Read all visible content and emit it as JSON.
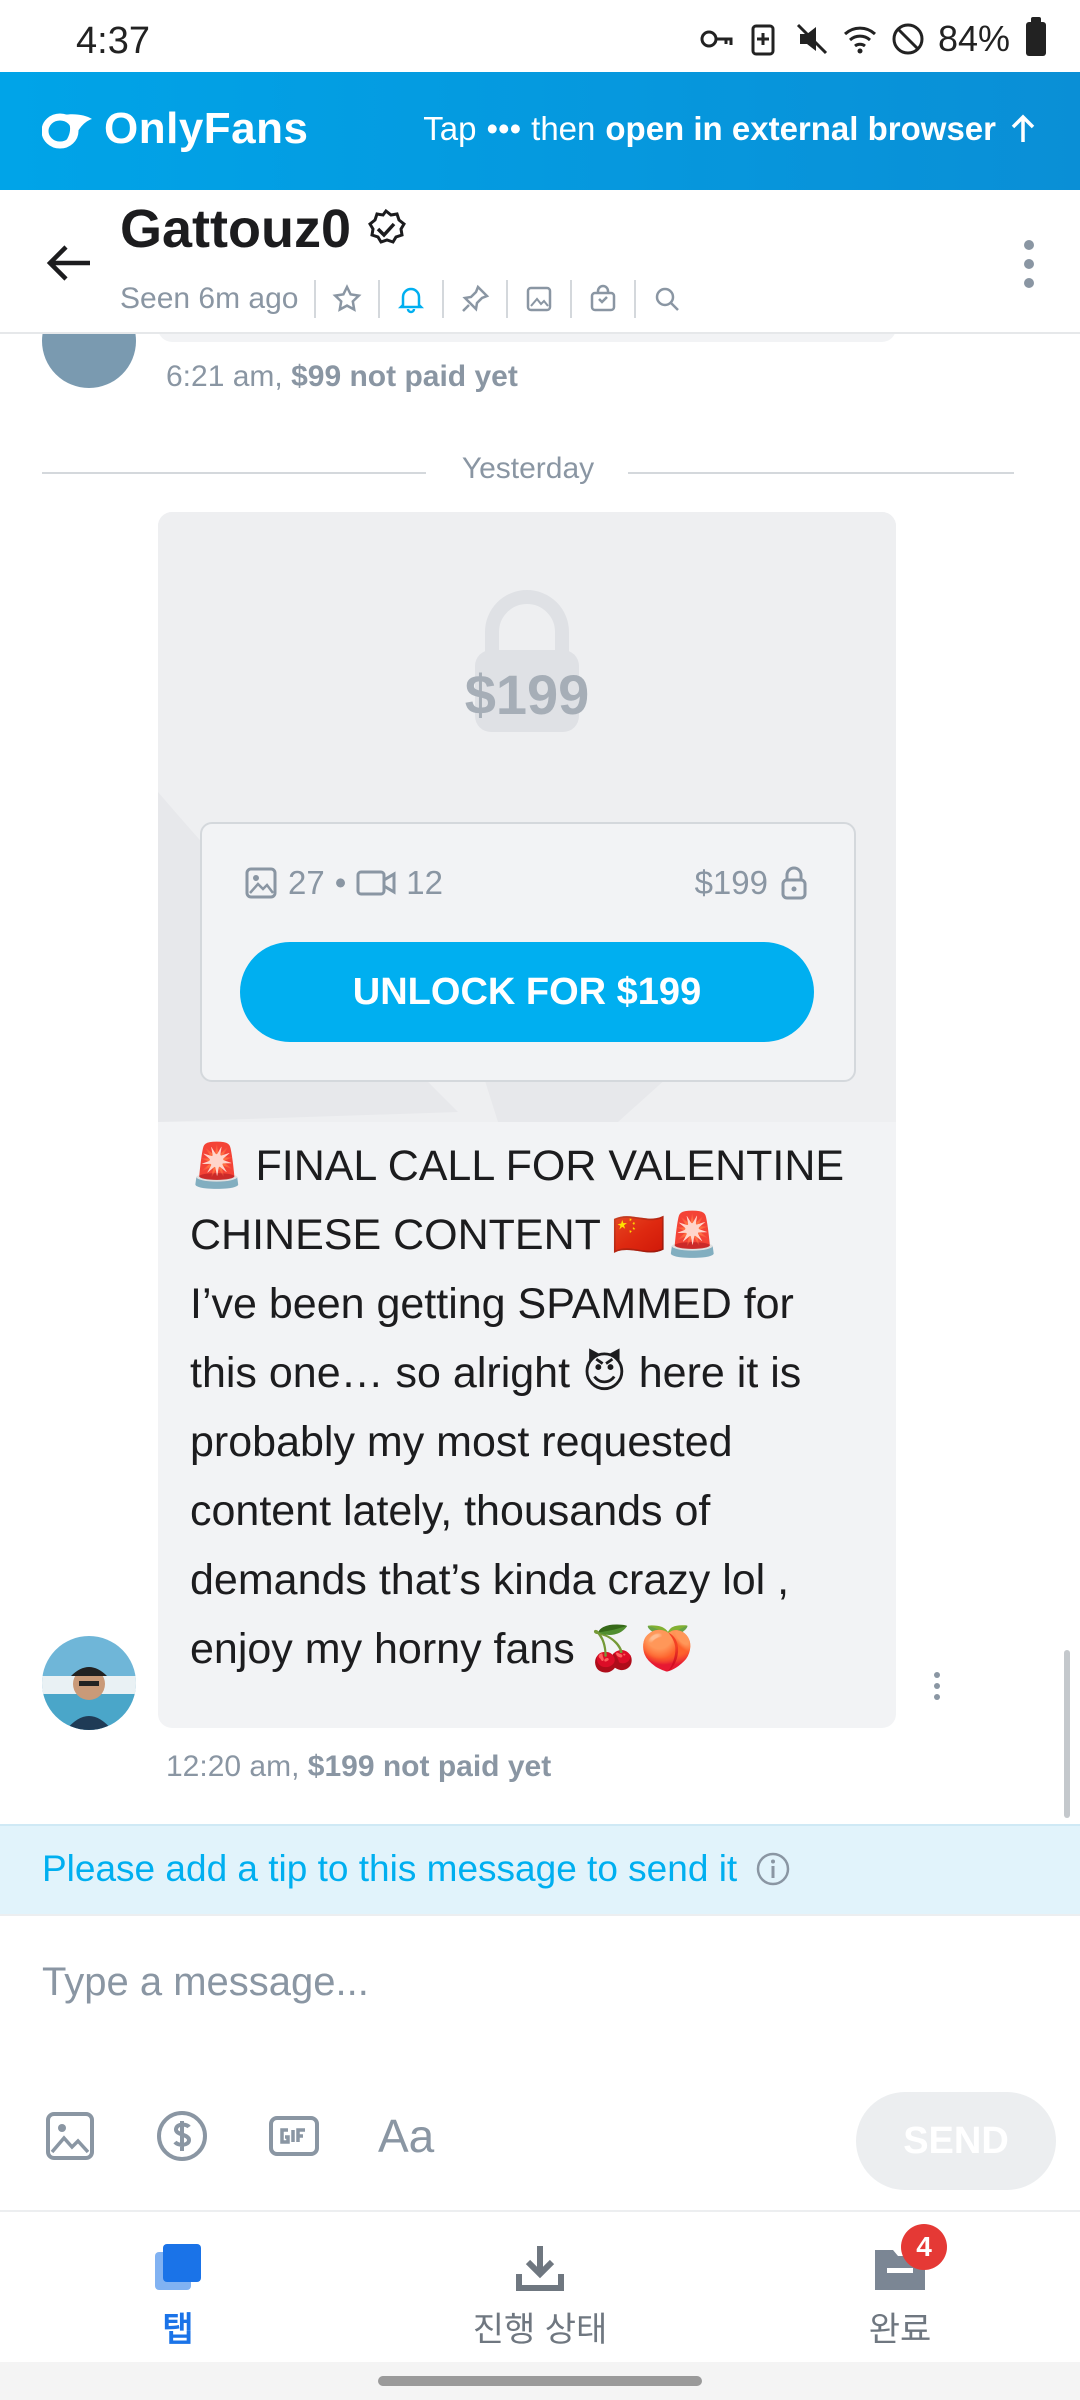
{
  "status_bar": {
    "time": "4:37",
    "battery": "84%"
  },
  "banner": {
    "brand": "OnlyFans",
    "hint_tap": "Tap",
    "hint_dots": "•••",
    "hint_then": "then",
    "hint_action": "open in external browser"
  },
  "header": {
    "username": "Gattouz0",
    "last_seen": "Seen 6m ago"
  },
  "chat": {
    "prev_time": "6:21 am,",
    "prev_status": "$99 not paid yet",
    "day_divider": "Yesterday",
    "message": {
      "price_watermark": "$199",
      "photo_count": "27",
      "dot": "•",
      "video_count": "12",
      "price": "$199",
      "unlock_label": "UNLOCK FOR $199",
      "text": "🚨 FINAL CALL FOR VALENTINE\nCHINESE CONTENT 🇨🇳🚨\nI’ve been getting SPAMMED for\nthis one… so alright 😈 here it is\nprobably my most requested\ncontent lately, thousands of\ndemands that’s kinda crazy lol ,\nenjoy my horny fans 🍒🍑",
      "time": "12:20 am,",
      "status": "$199 not paid yet"
    }
  },
  "tip_notice": "Please add a tip to this message to send it",
  "composer": {
    "placeholder": "Type a message...",
    "format_label": "Aa",
    "send_label": "SEND"
  },
  "bottom_nav": {
    "items": [
      {
        "label": "탭",
        "active": true
      },
      {
        "label": "진행 상태",
        "active": false
      },
      {
        "label": "완료",
        "active": false,
        "badge": "4"
      }
    ]
  },
  "colors": {
    "accent": "#00aff0",
    "banner": "#00a4e8",
    "muted": "#8a96a3",
    "badge": "#e53935"
  }
}
